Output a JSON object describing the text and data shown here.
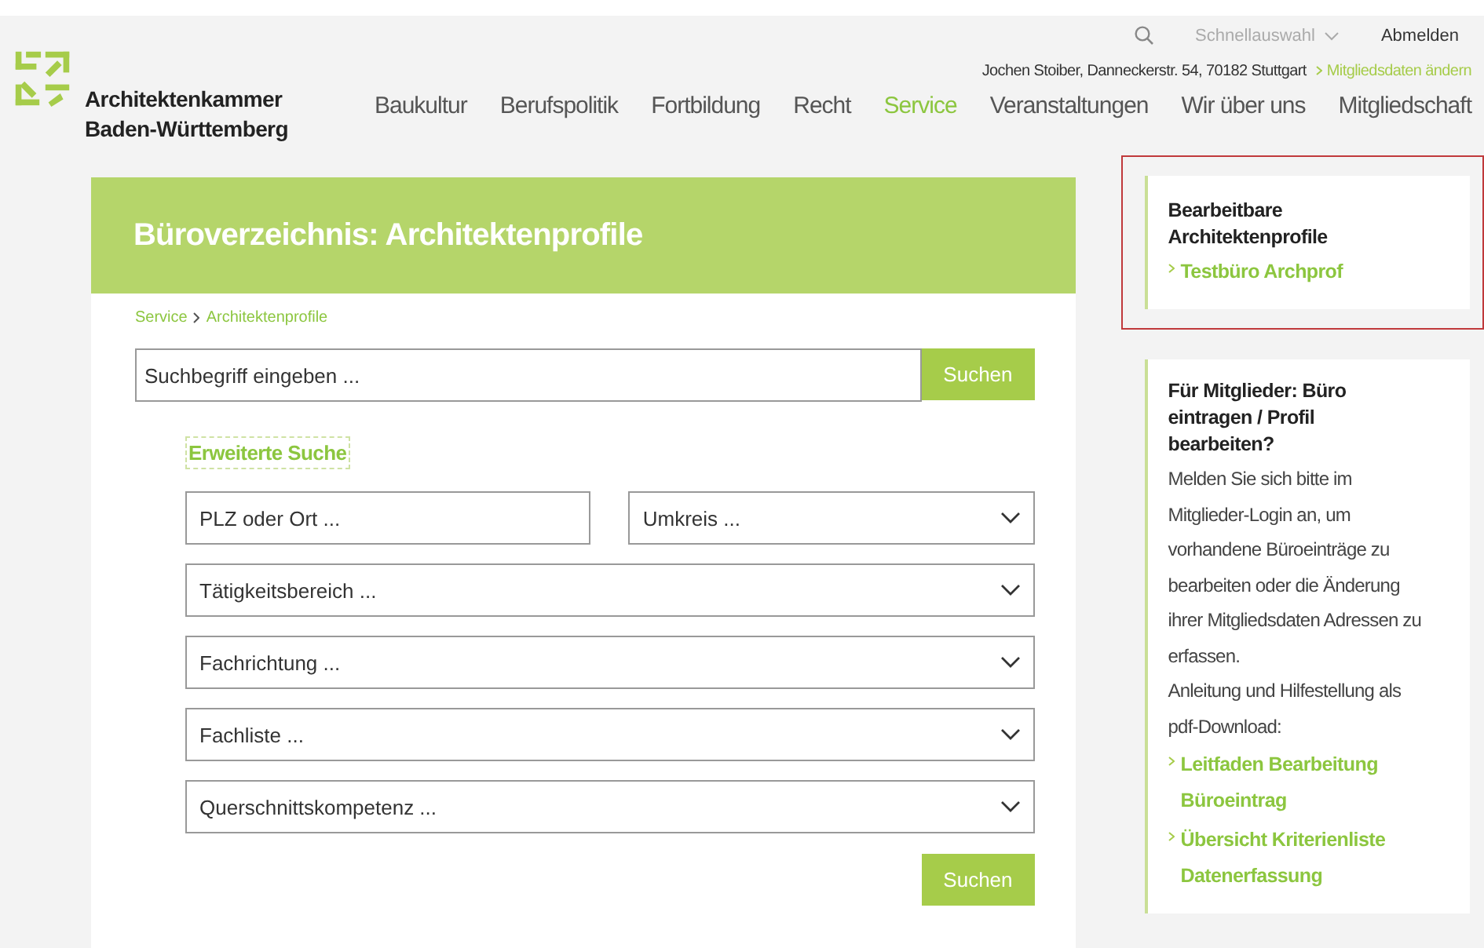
{
  "header": {
    "org_name": [
      "Architektenkammer",
      "Baden-Württemberg"
    ],
    "utility": {
      "quick_select": "Schnellauswahl",
      "logout": "Abmelden"
    },
    "user_line": "Jochen Stoiber, Danneckerstr. 54, 70182 Stuttgart",
    "member_link": "Mitgliedsdaten ändern"
  },
  "nav": [
    {
      "label": "Baukultur",
      "selected": false
    },
    {
      "label": "Berufspolitik",
      "selected": false
    },
    {
      "label": "Fortbildung",
      "selected": false
    },
    {
      "label": "Recht",
      "selected": false
    },
    {
      "label": "Service",
      "selected": true
    },
    {
      "label": "Veranstaltungen",
      "selected": false
    },
    {
      "label": "Wir über uns",
      "selected": false
    },
    {
      "label": "Mitgliedschaft",
      "selected": false
    }
  ],
  "main": {
    "title": "Büroverzeichnis: Architektenprofile",
    "breadcrumb": [
      "Service",
      "Architektenprofile"
    ],
    "search": {
      "placeholder": "Suchbegriff eingeben ...",
      "button": "Suchen"
    },
    "advanced_link": "Erweiterte Suche",
    "filter_rows": [
      [
        {
          "kind": "text",
          "placeholder": "PLZ oder Ort ..."
        },
        {
          "kind": "select",
          "placeholder": "Umkreis ..."
        }
      ],
      [
        {
          "kind": "select",
          "placeholder": "Tätigkeitsbereich ..."
        }
      ],
      [
        {
          "kind": "select",
          "placeholder": "Fachrichtung ..."
        }
      ],
      [
        {
          "kind": "select",
          "placeholder": "Fachliste ..."
        }
      ],
      [
        {
          "kind": "select",
          "placeholder": "Querschnittskompetenz ..."
        }
      ]
    ],
    "submit": "Suchen"
  },
  "sidebar": [
    {
      "title": "Bearbeitbare Architektenprofile",
      "highlighted": true,
      "links": [
        "Testbüro Archprof"
      ]
    },
    {
      "title": "Für Mitglieder: Büro eintragen / Profil bearbeiten?",
      "highlighted": false,
      "paragraphs": [
        "Melden Sie sich bitte im Mitglieder-Login an, um vorhandene Büroeinträge zu bearbeiten oder die Änderung ihrer Mitgliedsdaten Adressen zu erfassen.",
        "Anleitung und Hilfestellung als pdf-Download:"
      ],
      "links": [
        "Leitfaden Bearbeitung Büroeintrag",
        "Übersicht Kriterienliste Datenerfassung"
      ]
    }
  ]
}
